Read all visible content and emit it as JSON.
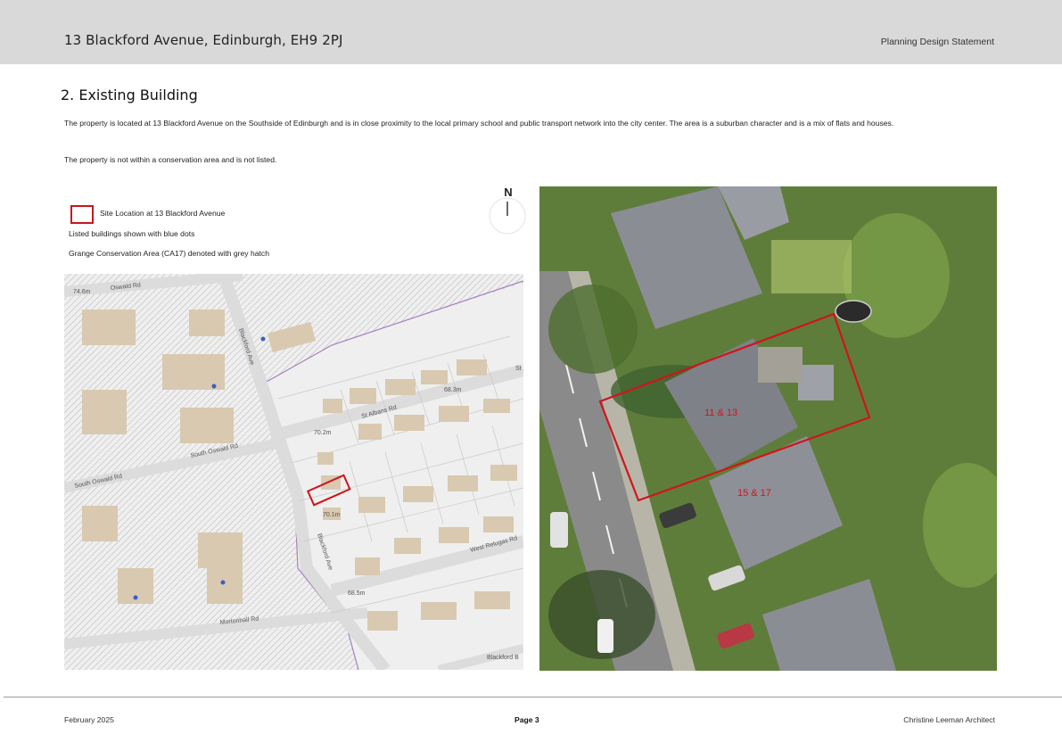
{
  "header": {
    "address": "13 Blackford Avenue, Edinburgh, EH9 2PJ",
    "document_title": "Planning Design Statement"
  },
  "section": {
    "title": "2. Existing Building",
    "paragraph_1": "The property is located at 13 Blackford Avenue on the Southside of Edinburgh and is in close proximity to the local primary school and public transport network into the city center.  The area is a suburban character and is a mix of flats and houses.",
    "paragraph_2": "The property is not within a conservation area and is not listed."
  },
  "legend": {
    "site_location": "Site Location at 13 Blackford Avenue",
    "listed_buildings": "Listed buildings shown with blue dots",
    "conservation_area": "Grange Conservation Area (CA17) denoted with grey hatch"
  },
  "north_arrow": {
    "label": "N"
  },
  "map": {
    "street_labels": {
      "oswald_rd": "Oswald Rd",
      "st_albans_rd": "St Albans Rd",
      "south_oswald_rd_1": "South Oswald Rd",
      "south_oswald_rd_2": "South Oswald Rd",
      "blackford_ave_1": "Blackford Ave",
      "blackford_ave_2": "Blackford Ave",
      "west_relugas_rd": "West Relugas Rd",
      "mortonhall_rd": "Mortonhall Rd",
      "blackford_b": "Blackford B",
      "st": "St"
    },
    "spot_heights": {
      "h1": "68.3m",
      "h2": "70.2m",
      "h3": "70.1m",
      "h4": "68.5m",
      "h5": "74.6m"
    },
    "colors": {
      "background": "#efefef",
      "building": "#d8c9b0",
      "hatch": "#8c8c8c",
      "road": "#dcdcdc",
      "conservation_boundary": "#a57fbd",
      "listed_dot": "#3a5fc4",
      "site_outline": "#d0141c"
    }
  },
  "aerial": {
    "labels": {
      "plot_a": "11 & 13",
      "plot_b": "15 & 17"
    }
  },
  "footer": {
    "date": "February 2025",
    "page": "Page  3",
    "author": "Christine Leeman Architect"
  }
}
